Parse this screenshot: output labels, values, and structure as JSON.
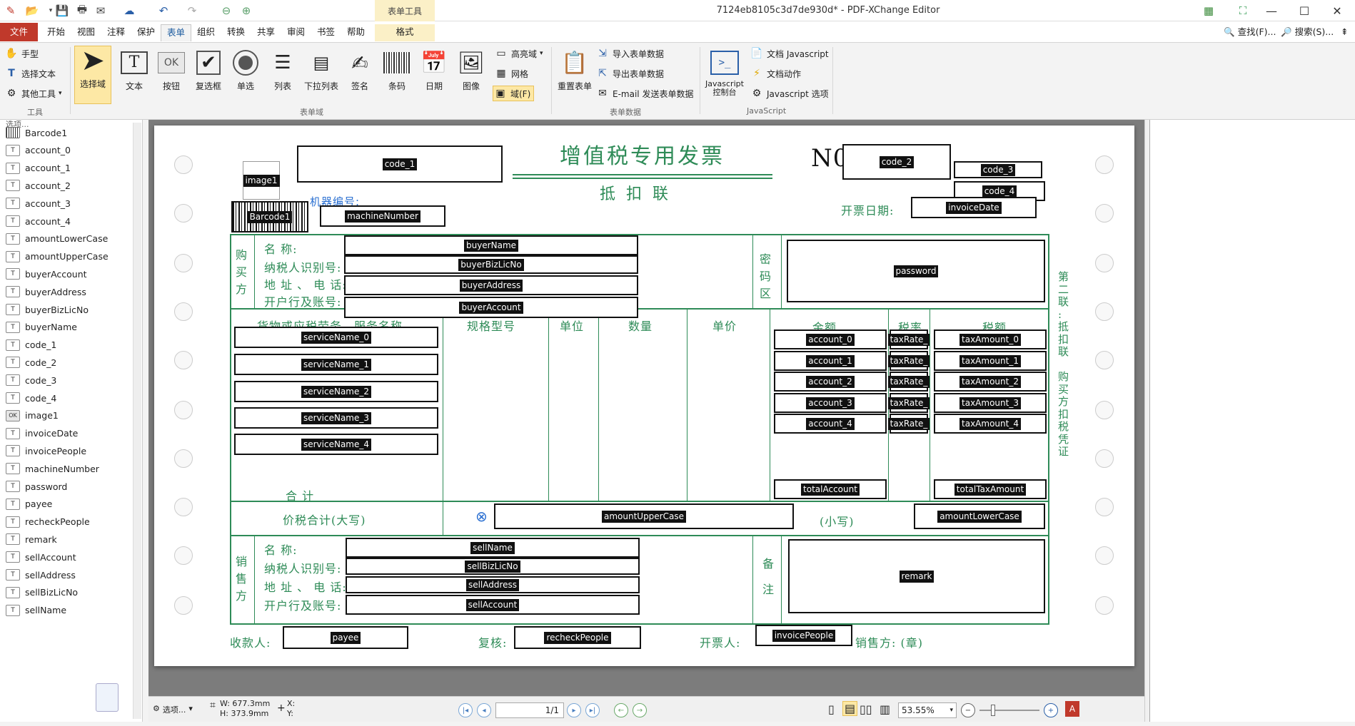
{
  "window": {
    "title": "7124eb8105c3d7de930d* - PDF-XChange Editor",
    "context_tab_group": "表单工具"
  },
  "menu": {
    "file": "文件",
    "tabs": [
      "开始",
      "视图",
      "注释",
      "保护",
      "表单",
      "组织",
      "转换",
      "共享",
      "审阅",
      "书签",
      "帮助",
      "格式"
    ],
    "active": "表单",
    "find": "查找(F)...",
    "search": "搜索(S)..."
  },
  "ribbon": {
    "tools": {
      "hand": "手型",
      "select_text": "选择文本",
      "other_tools": "其他工具",
      "group": "工具"
    },
    "form_fields": {
      "select_field": "选择域",
      "text": "文本",
      "button": "按钮",
      "checkbox": "复选框",
      "radio": "单选",
      "listbox": "列表",
      "dropdown": "下拉列表",
      "signature": "签名",
      "barcode": "条码",
      "date": "日期",
      "image": "图像",
      "highlight": "高亮域",
      "grid": "网格",
      "fields": "域(F)",
      "group": "表单域"
    },
    "ok_label": "OK",
    "form_data": {
      "reset": "重置表单",
      "import": "导入表单数据",
      "export": "导出表单数据",
      "email": "E-mail 发送表单数据",
      "group": "表单数据"
    },
    "javascript": {
      "console": "Javascript\n控制台",
      "doc_js": "文档 Javascript",
      "doc_actions": "文档动作",
      "js_options": "Javascript 选项",
      "group": "JavaScript"
    }
  },
  "left_panel": {
    "header": "选项...",
    "items": [
      {
        "icon": "barcode",
        "label": "Barcode1"
      },
      {
        "icon": "text",
        "label": "account_0"
      },
      {
        "icon": "text",
        "label": "account_1"
      },
      {
        "icon": "text",
        "label": "account_2"
      },
      {
        "icon": "text",
        "label": "account_3"
      },
      {
        "icon": "text",
        "label": "account_4"
      },
      {
        "icon": "text",
        "label": "amountLowerCase"
      },
      {
        "icon": "text",
        "label": "amountUpperCase"
      },
      {
        "icon": "text",
        "label": "buyerAccount"
      },
      {
        "icon": "text",
        "label": "buyerAddress"
      },
      {
        "icon": "text",
        "label": "buyerBizLicNo"
      },
      {
        "icon": "text",
        "label": "buyerName"
      },
      {
        "icon": "text",
        "label": "code_1"
      },
      {
        "icon": "text",
        "label": "code_2"
      },
      {
        "icon": "text",
        "label": "code_3"
      },
      {
        "icon": "text",
        "label": "code_4"
      },
      {
        "icon": "ok",
        "label": "image1"
      },
      {
        "icon": "text",
        "label": "invoiceDate"
      },
      {
        "icon": "text",
        "label": "invoicePeople"
      },
      {
        "icon": "text",
        "label": "machineNumber"
      },
      {
        "icon": "text",
        "label": "password"
      },
      {
        "icon": "text",
        "label": "payee"
      },
      {
        "icon": "text",
        "label": "recheckPeople"
      },
      {
        "icon": "text",
        "label": "remark"
      },
      {
        "icon": "text",
        "label": "sellAccount"
      },
      {
        "icon": "text",
        "label": "sellAddress"
      },
      {
        "icon": "text",
        "label": "sellBizLicNo"
      },
      {
        "icon": "text",
        "label": "sellName"
      }
    ]
  },
  "invoice": {
    "title": "增值税专用发票",
    "subtitle": "抵 扣 联",
    "no_label": "N0",
    "machine_label": "机器编号:",
    "date_label": "开票日期:",
    "buyer_side": "购\n买\n方",
    "seller_side": "销\n售\n方",
    "name_label": "名        称:",
    "tax_id_label": "纳税人识别号:",
    "address_label": "地 址 、 电 话:",
    "bank_label": "开户行及账号:",
    "password_area": "密\n码\n区",
    "col_goods": "货物或应税劳务、服务名称",
    "col_spec": "规格型号",
    "col_unit": "单位",
    "col_qty": "数量",
    "col_price": "单价",
    "col_amount": "金额",
    "col_rate": "税率",
    "col_tax": "税额",
    "total_label": "合        计",
    "total_tax_label": "价税合计(大写)",
    "small_label": "(小写)",
    "remark_label": "备\n\n注",
    "payee_label": "收款人:",
    "recheck_label": "复核:",
    "invoicer_label": "开票人:",
    "seller_seal": "销售方: (章)",
    "side_note": "第\n二\n联\n:\n抵\n扣\n联\n\n购\n买\n方\n扣\n税\n凭\n证",
    "fields": {
      "code_1": "code_1",
      "code_2": "code_2",
      "code_3": "code_3",
      "code_4": "code_4",
      "image1": "image1",
      "barcode": "Barcode1",
      "machineNumber": "machineNumber",
      "invoiceDate": "invoiceDate",
      "buyerName": "buyerName",
      "buyerBizLicNo": "buyerBizLicNo",
      "buyerAddress": "buyerAddress",
      "buyerAccount": "buyerAccount",
      "password": "password",
      "serviceName": [
        "serviceName_0",
        "serviceName_1",
        "serviceName_2",
        "serviceName_3",
        "serviceName_4"
      ],
      "account": [
        "account_0",
        "account_1",
        "account_2",
        "account_3",
        "account_4"
      ],
      "taxRate": [
        "taxRate_",
        "taxRate_",
        "taxRate_",
        "taxRate_",
        "taxRate_"
      ],
      "taxAmount": [
        "taxAmount_0",
        "taxAmount_1",
        "taxAmount_2",
        "taxAmount_3",
        "taxAmount_4"
      ],
      "totalAccount": "totalAccount",
      "totalTaxAmount": "totalTaxAmount",
      "amountUpperCase": "amountUpperCase",
      "amountLowerCase": "amountLowerCase",
      "sellName": "sellName",
      "sellBizLicNo": "sellBizLicNo",
      "sellAddress": "sellAddress",
      "sellAccount": "sellAccount",
      "remark": "remark",
      "payee": "payee",
      "recheckPeople": "recheckPeople",
      "invoicePeople": "invoicePeople"
    }
  },
  "status": {
    "options": "选项...",
    "width": "W: 677.3mm",
    "height": "H: 373.9mm",
    "x": "X:",
    "y": "Y:",
    "page": "1/1",
    "zoom": "53.55%"
  }
}
